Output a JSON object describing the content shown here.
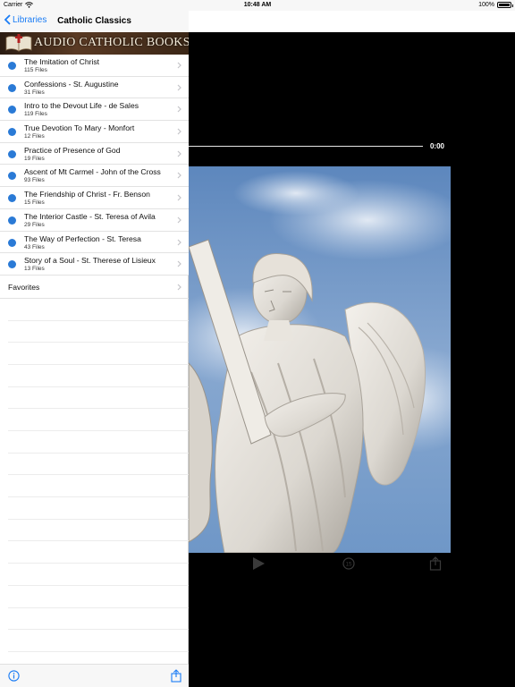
{
  "status_bar": {
    "carrier": "Carrier",
    "time": "10:48 AM",
    "battery": "100%"
  },
  "nav": {
    "back_label": "Libraries",
    "title": "Catholic Classics"
  },
  "banner": {
    "text": "AUDIO CATHOLIC BOOKS",
    "logo_icon": "open-book-icon"
  },
  "books": [
    {
      "title": "The Imitation of Christ",
      "files": "115 Files"
    },
    {
      "title": "Confessions - St. Augustine",
      "files": "31 Files"
    },
    {
      "title": "Intro to the Devout Life - de Sales",
      "files": "119 Files"
    },
    {
      "title": "True Devotion To Mary - Monfort",
      "files": "12 Files"
    },
    {
      "title": "Practice of Presence of God",
      "files": "19 Files"
    },
    {
      "title": "Ascent of Mt Carmel - John of the Cross",
      "files": "93 Files"
    },
    {
      "title": "The Friendship of Christ - Fr. Benson",
      "files": "15 Files"
    },
    {
      "title": "The Interior Castle - St. Teresa of Avila",
      "files": "29 Files"
    },
    {
      "title": "The Way of Perfection - St. Teresa",
      "files": "43 Files"
    },
    {
      "title": "Story of a Soul - St. Therese of Lisieux",
      "files": "13 Files"
    }
  ],
  "favorites_label": "Favorites",
  "player": {
    "elapsed": "0:00",
    "artwork": "angel-statue-image",
    "controls": [
      "play-icon",
      "replay-15-icon",
      "share-icon"
    ]
  },
  "colors": {
    "accent": "#1a7cf5",
    "dot": "#2a7ad6",
    "banner_bg": "#3a2616",
    "sky": "#6d94c4"
  }
}
